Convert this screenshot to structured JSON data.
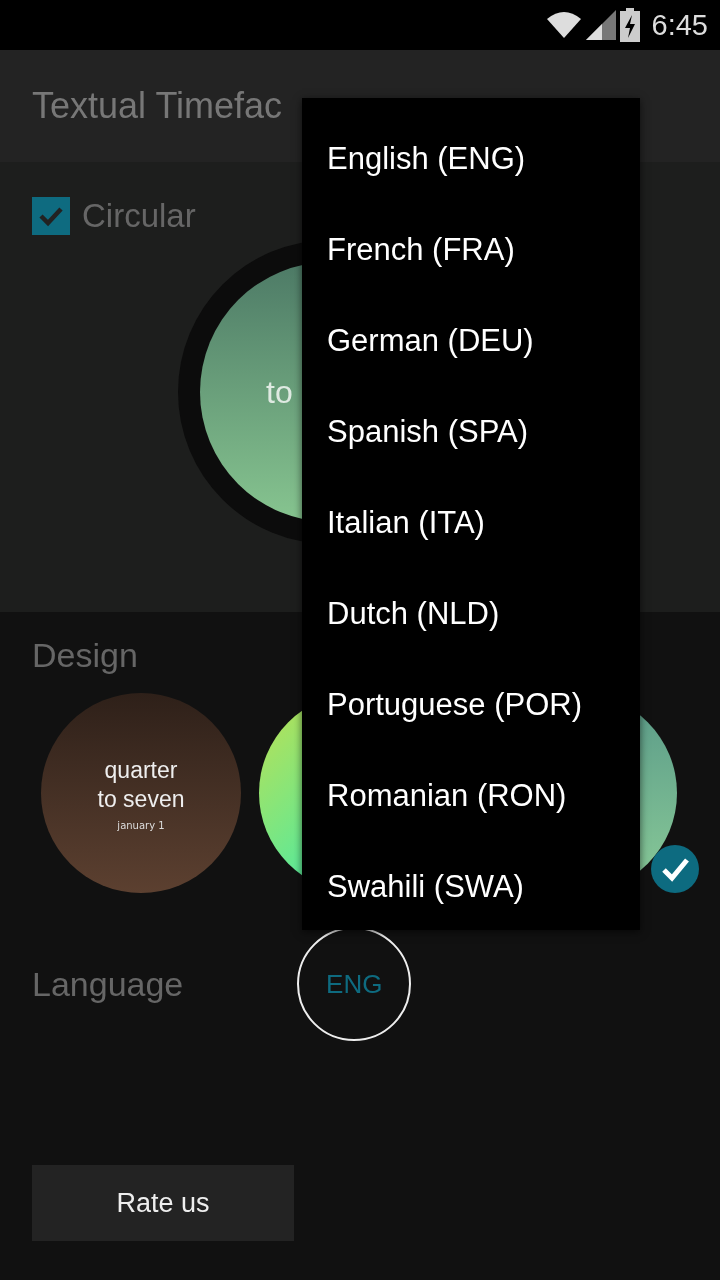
{
  "status_bar": {
    "time": "6:45"
  },
  "app_bar": {
    "title": "Textual Timefac"
  },
  "preview": {
    "circular": {
      "label": "Circular",
      "checked": true
    },
    "face_text": "to"
  },
  "design": {
    "label": "Design",
    "items": [
      {
        "kind": "brown",
        "lines": [
          "quarter",
          "to seven"
        ],
        "date": "january 1",
        "selected": false
      },
      {
        "kind": "lime",
        "selected": false
      },
      {
        "kind": "green",
        "selected": true
      }
    ]
  },
  "language": {
    "label": "Language",
    "value": "ENG"
  },
  "rate_button": "Rate us",
  "dropdown": {
    "items": [
      {
        "label": "English (ENG)"
      },
      {
        "label": "French (FRA)"
      },
      {
        "label": "German (DEU)"
      },
      {
        "label": "Spanish (SPA)"
      },
      {
        "label": "Italian (ITA)"
      },
      {
        "label": "Dutch (NLD)"
      },
      {
        "label": "Portuguese (POR)"
      },
      {
        "label": "Romanian (RON)"
      },
      {
        "label": "Swahili (SWA)"
      }
    ]
  }
}
